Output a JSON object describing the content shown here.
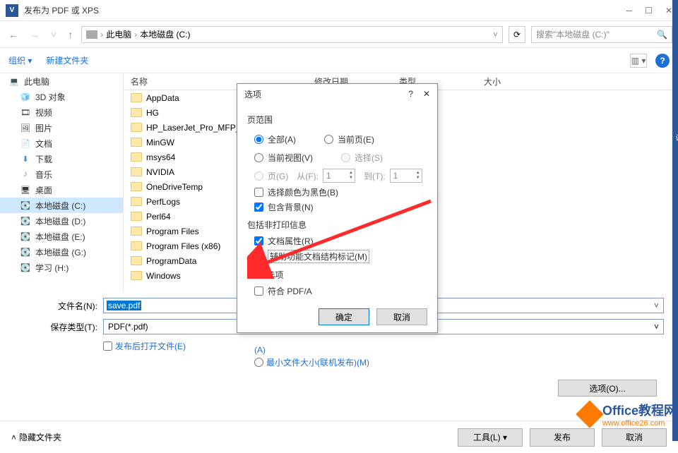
{
  "window": {
    "title": "发布为 PDF 或 XPS"
  },
  "breadcrumb": {
    "root": "此电脑",
    "drive": "本地磁盘 (C:)"
  },
  "search": {
    "placeholder": "搜索\"本地磁盘 (C:)\""
  },
  "toolbar": {
    "organize": "组织 ▾",
    "newfolder": "新建文件夹",
    "view_menu": "▥ ▾"
  },
  "sidebar": {
    "root": "此电脑",
    "items": [
      {
        "label": "3D 对象",
        "icon": "🧊"
      },
      {
        "label": "视频",
        "icon": "🎞"
      },
      {
        "label": "图片",
        "icon": "🖼"
      },
      {
        "label": "文档",
        "icon": "📄"
      },
      {
        "label": "下载",
        "icon": "⬇"
      },
      {
        "label": "音乐",
        "icon": "♪"
      },
      {
        "label": "桌面",
        "icon": "🖥"
      },
      {
        "label": "本地磁盘 (C:)",
        "icon": "💽",
        "selected": true
      },
      {
        "label": "本地磁盘 (D:)",
        "icon": "💽"
      },
      {
        "label": "本地磁盘 (E:)",
        "icon": "💽"
      },
      {
        "label": "本地磁盘 (G:)",
        "icon": "💽"
      },
      {
        "label": "学习 (H:)",
        "icon": "💽"
      }
    ]
  },
  "columns": {
    "name": "名称",
    "date": "修改日期",
    "type": "类型",
    "size": "大小"
  },
  "files": [
    "AppData",
    "HG",
    "HP_LaserJet_Pro_MFP_",
    "MinGW",
    "msys64",
    "NVIDIA",
    "OneDriveTemp",
    "PerfLogs",
    "Perl64",
    "Program Files",
    "Program Files (x86)",
    "ProgramData",
    "Windows"
  ],
  "save": {
    "filename_label": "文件名(N):",
    "filename_value": "save.pdf",
    "type_label": "保存类型(T):",
    "type_value": "PDF(*.pdf)",
    "open_after": "发布后打开文件(E)",
    "opt_link1": "(A)",
    "opt_link2": "最小文件大小(联机发布)(M)",
    "options_btn": "选项(O)..."
  },
  "footer": {
    "hide": "隐藏文件夹",
    "tools": "工具(L) ▾",
    "publish": "发布",
    "cancel": "取消"
  },
  "dialog": {
    "title": "选项",
    "g_range": "页范围",
    "r_all": "全部(A)",
    "r_current": "当前页(E)",
    "r_current_view": "当前视图(V)",
    "r_select": "选择(S)",
    "r_pages": "页(G)",
    "from": "从(F):",
    "to": "到(T):",
    "from_val": "1",
    "to_val": "1",
    "c_bw": "选择颜色为黑色(B)",
    "c_bg": "包含背景(N)",
    "g_nonprint": "包括非打印信息",
    "c_docprops": "文档属性(R)",
    "c_accessibility": "辅助功能文档结构标记(M)",
    "g_pdf": "PDF 选项",
    "c_pdfa": "符合 PDF/A",
    "ok": "确定",
    "cancel": "取消"
  },
  "watermark": {
    "brand": "Office教程网",
    "url": "www.office26.com"
  }
}
